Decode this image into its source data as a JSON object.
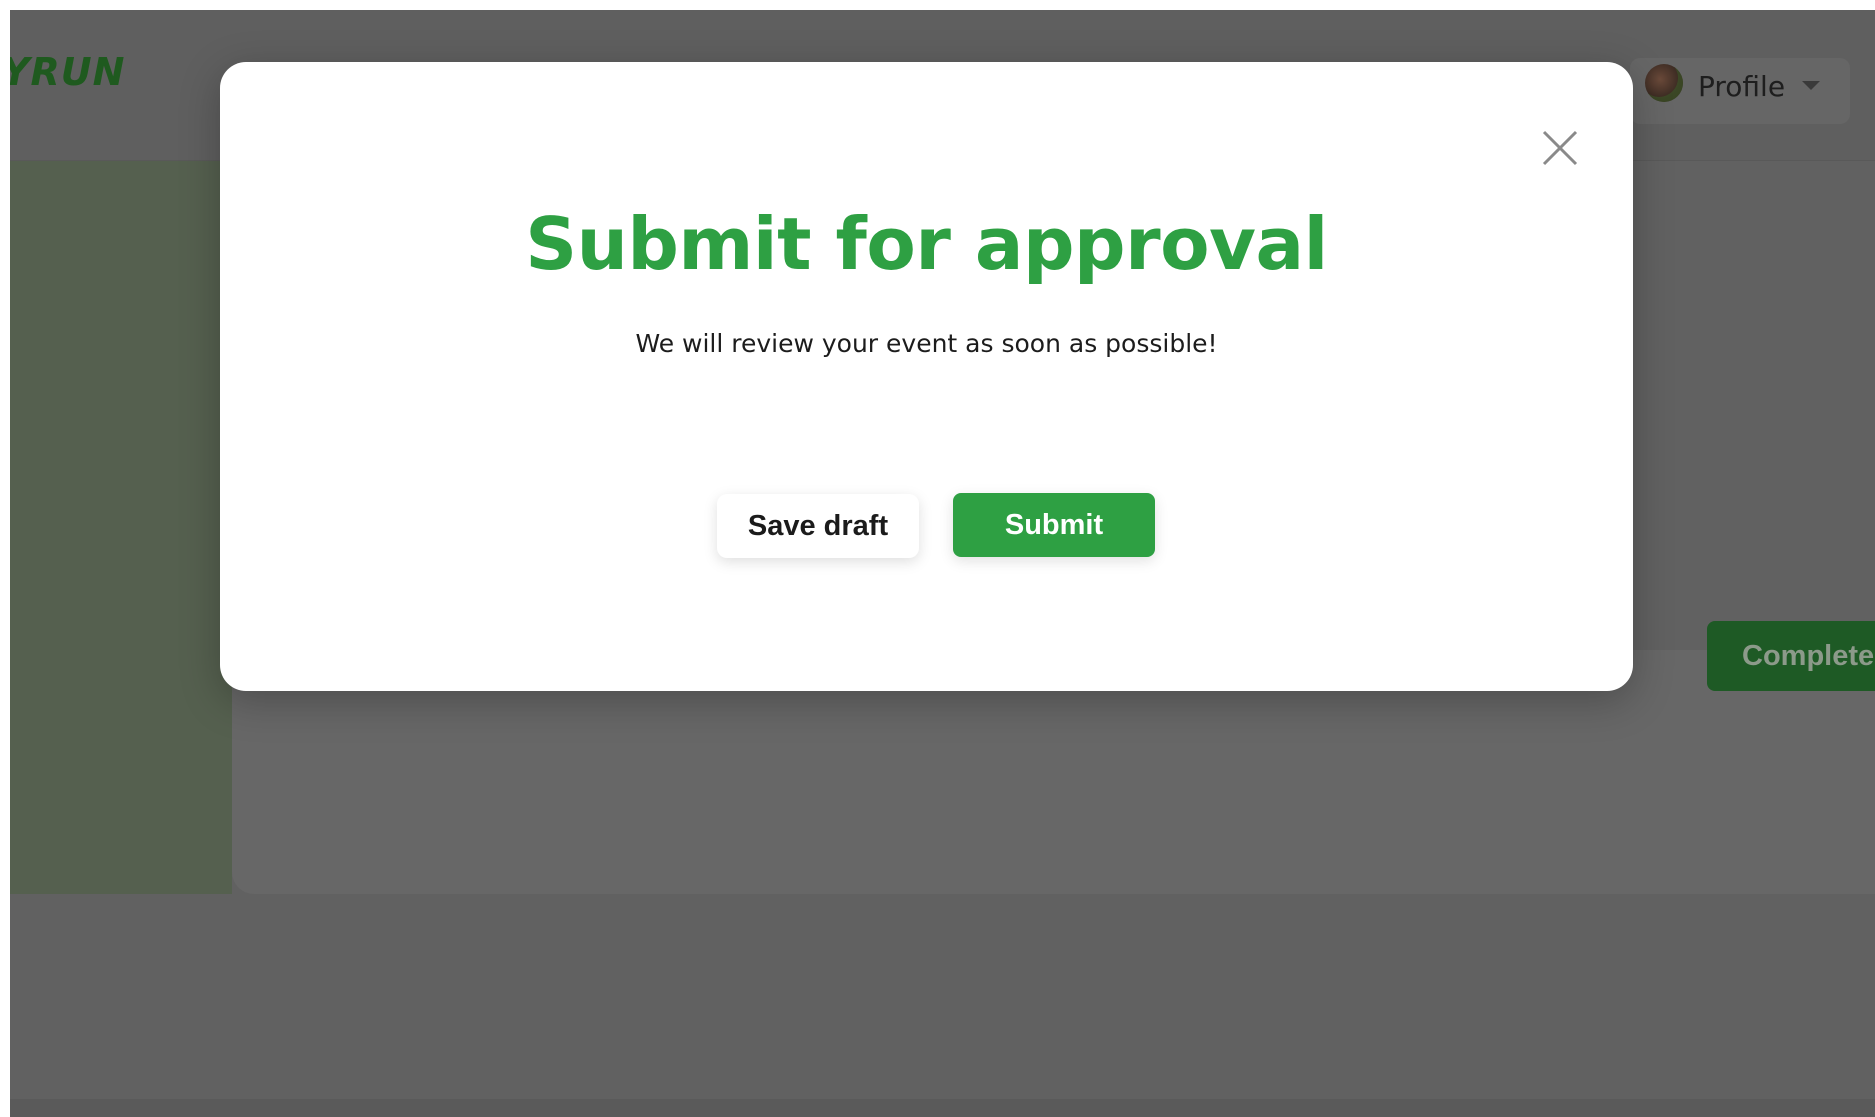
{
  "app": {
    "logo_text": "YRUN",
    "brand_color": "#2ea043"
  },
  "header": {
    "profile_label": "Profile",
    "avatar_icon": "avatar",
    "caret_icon": "caret-down-icon"
  },
  "background": {
    "complete_button_label": "Complete"
  },
  "modal": {
    "title": "Submit for approval",
    "subtitle": "We will review your event as soon as possible!",
    "close_icon": "close-icon",
    "save_draft_label": "Save draft",
    "submit_label": "Submit"
  }
}
